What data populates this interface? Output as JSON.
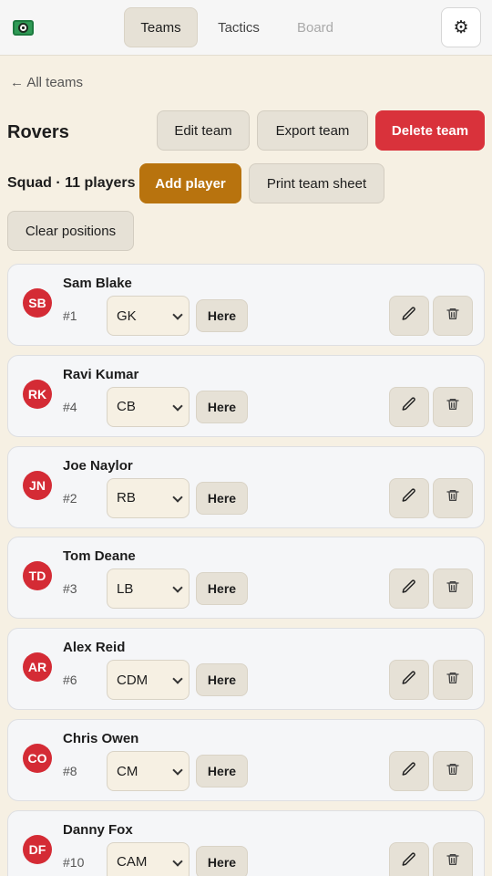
{
  "nav": {
    "tabs": [
      {
        "label": "Teams"
      },
      {
        "label": "Tactics"
      },
      {
        "label": "Board"
      }
    ]
  },
  "back_label": "← All teams",
  "team": {
    "name": "Rovers",
    "edit_label": "Edit team",
    "export_label": "Export team",
    "delete_label": "Delete team"
  },
  "squad": {
    "label": "Squad · 11 players",
    "add_label": "Add player",
    "print_label": "Print team sheet",
    "clear_label": "Clear positions"
  },
  "here_label": "Here",
  "players": [
    {
      "initials": "SB",
      "name": "Sam Blake",
      "number": "#1",
      "position": "GK"
    },
    {
      "initials": "RK",
      "name": "Ravi Kumar",
      "number": "#4",
      "position": "CB"
    },
    {
      "initials": "JN",
      "name": "Joe Naylor",
      "number": "#2",
      "position": "RB"
    },
    {
      "initials": "TD",
      "name": "Tom Deane",
      "number": "#3",
      "position": "LB"
    },
    {
      "initials": "AR",
      "name": "Alex Reid",
      "number": "#6",
      "position": "CDM"
    },
    {
      "initials": "CO",
      "name": "Chris Owen",
      "number": "#8",
      "position": "CM"
    },
    {
      "initials": "DF",
      "name": "Danny Fox",
      "number": "#10",
      "position": "CAM"
    }
  ],
  "colors": {
    "accent_delete": "#d9323b",
    "accent_add": "#b8730e",
    "avatar": "#d42b35",
    "background": "#f6f0e3"
  }
}
